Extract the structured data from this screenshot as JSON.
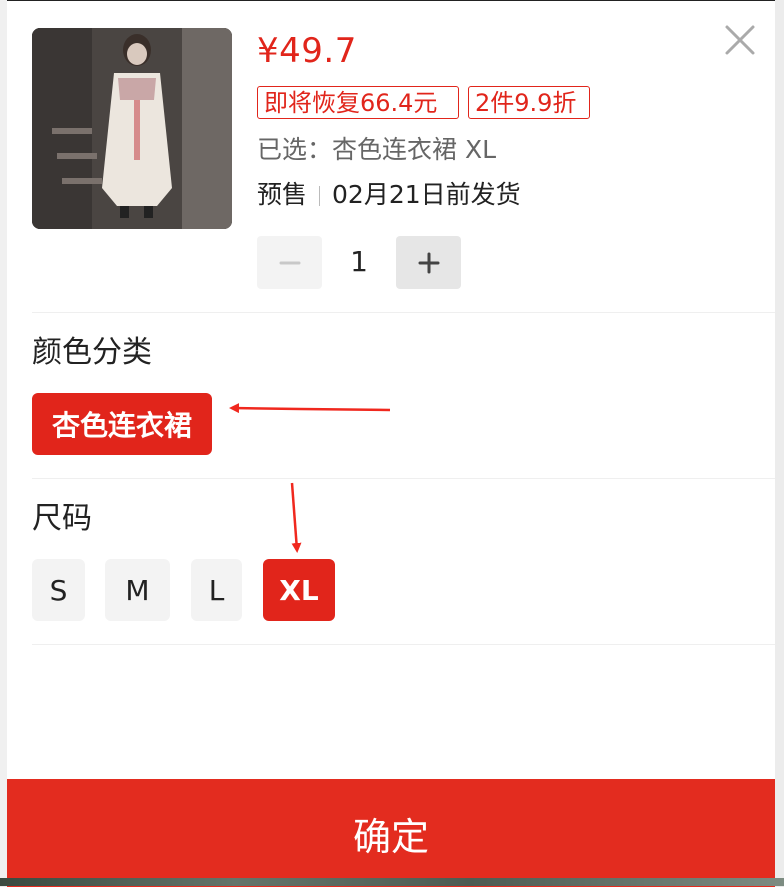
{
  "product": {
    "currency_symbol": "¥",
    "price": "49.7",
    "tags": [
      "即将恢复66.4元",
      "2件9.9折"
    ],
    "selected_text": "已选：杏色连衣裙 XL",
    "presale_label": "预售",
    "ship_text": "02月21日前发货",
    "quantity": "1"
  },
  "icons": {
    "close": "close-icon",
    "minus": "minus-icon",
    "plus": "plus-icon",
    "annotation_arrow": "arrow-annotation"
  },
  "color_section": {
    "title": "颜色分类",
    "options": [
      {
        "label": "杏色连衣裙",
        "selected": true
      }
    ]
  },
  "size_section": {
    "title": "尺码",
    "options": [
      {
        "label": "S",
        "selected": false
      },
      {
        "label": "M",
        "selected": false
      },
      {
        "label": "L",
        "selected": false
      },
      {
        "label": "XL",
        "selected": true
      }
    ]
  },
  "confirm_label": "确定",
  "colors": {
    "accent": "#e1251b",
    "confirm_bg": "#e32c1f",
    "chip_bg": "#f3f3f3"
  }
}
